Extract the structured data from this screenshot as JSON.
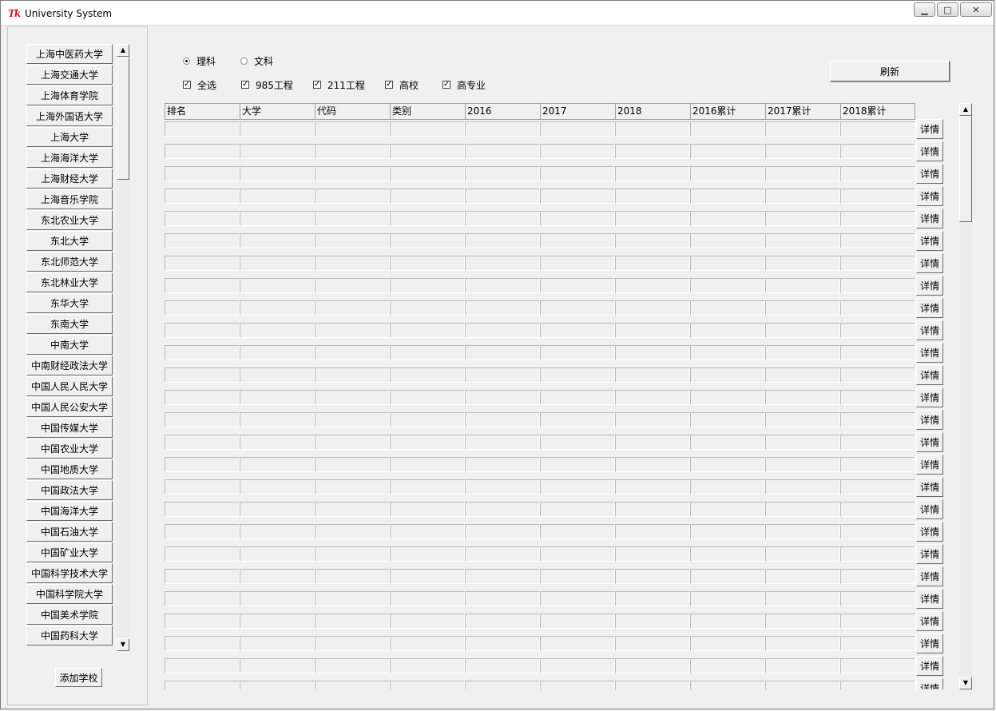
{
  "window": {
    "title": "University System"
  },
  "schools": [
    "上海中医药大学",
    "上海交通大学",
    "上海体育学院",
    "上海外国语大学",
    "上海大学",
    "上海海洋大学",
    "上海财经大学",
    "上海音乐学院",
    "东北农业大学",
    "东北大学",
    "东北师范大学",
    "东北林业大学",
    "东华大学",
    "东南大学",
    "中南大学",
    "中南财经政法大学",
    "中国人民人民大学",
    "中国人民公安大学",
    "中国传媒大学",
    "中国农业大学",
    "中国地质大学",
    "中国政法大学",
    "中国海洋大学",
    "中国石油大学",
    "中国矿业大学",
    "中国科学技术大学",
    "中国科学院大学",
    "中国美术学院",
    "中国药科大学"
  ],
  "add_school_label": "添加学校",
  "radios": [
    {
      "label": "理科",
      "selected": true
    },
    {
      "label": "文科",
      "selected": false
    }
  ],
  "checks": [
    {
      "label": "全选",
      "checked": true
    },
    {
      "label": "985工程",
      "checked": true
    },
    {
      "label": "211工程",
      "checked": true
    },
    {
      "label": "高校",
      "checked": true
    },
    {
      "label": "高专业",
      "checked": true
    }
  ],
  "refresh_label": "刷新",
  "table": {
    "headers": [
      "排名",
      "大学",
      "代码",
      "类别",
      "2016",
      "2017",
      "2018",
      "2016累计",
      "2017累计",
      "2018累计"
    ],
    "detail_label": "详情",
    "row_count": 26
  }
}
